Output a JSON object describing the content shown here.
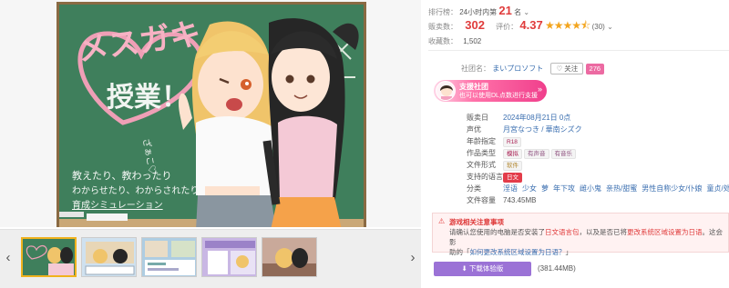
{
  "gallery": {
    "prev_icon": "chevron-left-icon",
    "next_icon": "chevron-right-icon",
    "cover_title_line1": "メスガキ",
    "cover_title_line2": "授業！",
    "cover_sub1": "教えたり、教わったり",
    "cover_sub2": "わからせたり、わからされたり",
    "cover_sub3": "育成シミュレーション",
    "board_chalk": "ざぁこ♡",
    "thumbnail_count": 5,
    "active_thumbnail": 1
  },
  "stats": {
    "rank_label": "排行榜：",
    "rank_period": "24小时内第",
    "rank_value": "21",
    "rank_suffix": "名",
    "rank_icon": "chevron-down-icon",
    "sales_label": "贩卖数：",
    "sales_value": "302",
    "rating_label": "评价：",
    "rating_value": "4.37",
    "rating_stars": "★★★★⯪",
    "rating_stars_fraction": 0.874,
    "rating_count": "(30)",
    "rating_dropdown_icon": "chevron-down-icon",
    "fav_label": "收藏数：",
    "fav_value": "1,502"
  },
  "circle": {
    "label": "社团名：",
    "name": "まいプロソフト",
    "follow_label": "关注",
    "follow_icon": "heart-icon",
    "follow_count": "276"
  },
  "banner": {
    "title": "支援社团",
    "subtitle": "也可以使用DL点数进行支援",
    "arrow": "»"
  },
  "info": {
    "release_label": "贩卖日",
    "release_value": "2024年08月21日 0点",
    "voice_label": "声优",
    "voice_value": "月宮なつき / 華南シズク",
    "age_label": "年龄指定",
    "age_value": "R18",
    "type_label": "作品类型",
    "type_tags": [
      "模拟",
      "有声音",
      "有音乐"
    ],
    "format_label": "文件形式",
    "format_value": "软件",
    "lang_label": "支持的语言",
    "lang_value": "日文",
    "genre_label": "分类",
    "genres": [
      "淫语",
      "少女",
      "萝",
      "年下攻",
      "雌小鬼",
      "亲热/甜蜜",
      "男性自称少女/仆娘",
      "童贞/处男"
    ],
    "size_label": "文件容量",
    "size_value": "743.45MB"
  },
  "notice": {
    "icon": "warning-icon",
    "title": "游戏相关注意事项",
    "body_a": "请确认您使用的电脑是否安装了",
    "body_link1": "日文语言包",
    "body_b": "，以及是否已将",
    "body_link2": "更改系统区域设置为日语",
    "body_c": "。这会影",
    "body_d": "助的「",
    "body_link3": "如何更改系统区域设置为日语？",
    "body_e": "」"
  },
  "download": {
    "button_label": "下载体验版",
    "button_icon": "download-icon",
    "size": "(381.44MB)"
  },
  "colors": {
    "accent_red": "#e03c3c",
    "pink": "#ec6aa2",
    "purple_button": "#9b72d6",
    "star": "#f3a51e",
    "link": "#3b6fb0"
  }
}
